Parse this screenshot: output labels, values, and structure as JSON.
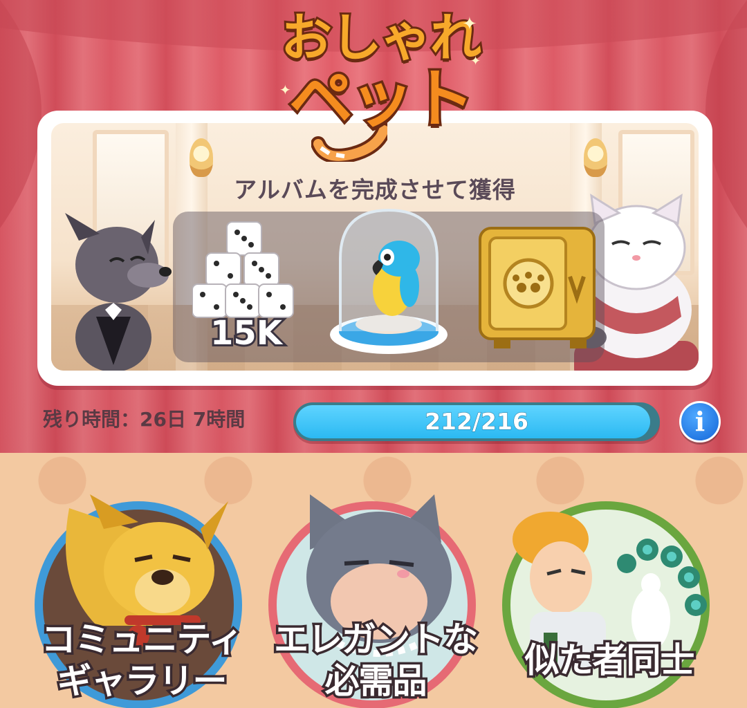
{
  "event": {
    "title_line1": "おしゃれ",
    "title_line2": "ペット",
    "subtitle": "アルバムを完成させて獲得"
  },
  "rewards": [
    {
      "icon": "dice-stack-icon",
      "amount": "15K"
    },
    {
      "icon": "parrot-in-dome-icon"
    },
    {
      "icon": "golden-safe-icon"
    }
  ],
  "timer": {
    "label": "残り時間：26日 7時間"
  },
  "progress": {
    "text": "212/216",
    "fraction": 0.981
  },
  "info_button": {
    "label": "i"
  },
  "albums": [
    {
      "label_line1": "コミュニティ",
      "label_line2": "ギャラリー",
      "ring_color": "#3f9ad8",
      "icon": "dog-icon"
    },
    {
      "label_line1": "エレガントな",
      "label_line2": "必需品",
      "ring_color": "#e66a74",
      "icon": "cat-icon"
    },
    {
      "label_line1": "似た者同士",
      "label_line2": "",
      "ring_color": "#6aa63f",
      "icon": "peacock-lady-icon"
    }
  ],
  "colors": {
    "curtain": "#e35f6a",
    "gallery_bg": "#f3c9a1",
    "progress_fill": "#2bb9f2",
    "title_orange": "#f58c1f"
  }
}
